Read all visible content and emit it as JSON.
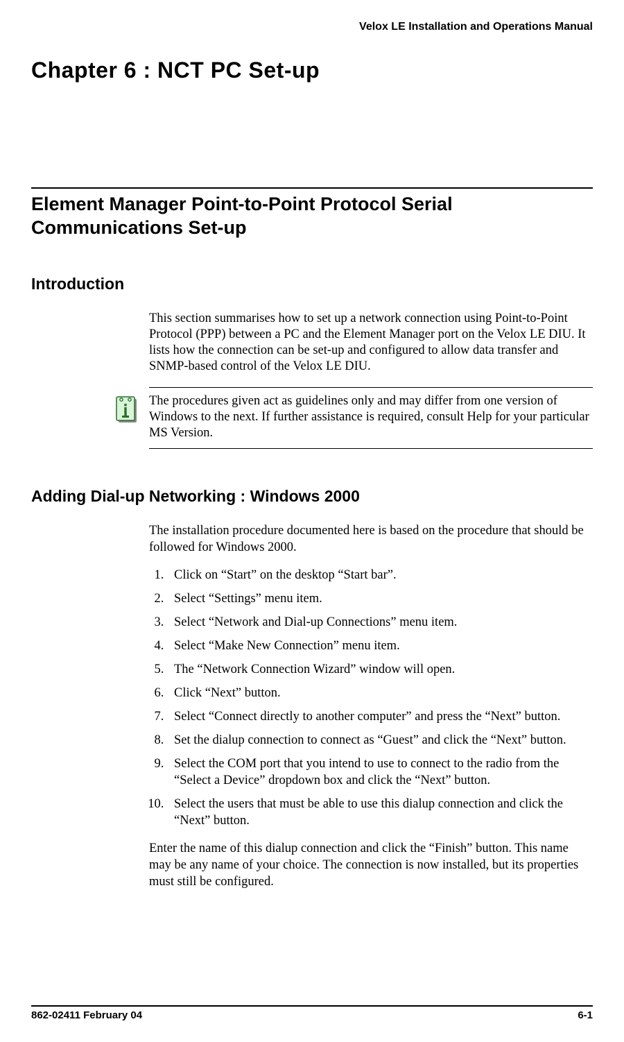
{
  "header": {
    "manual_title": "Velox LE Installation and Operations Manual"
  },
  "chapter": {
    "title": "Chapter 6 : NCT PC Set-up"
  },
  "section": {
    "title": "Element Manager Point-to-Point Protocol Serial Communications Set-up"
  },
  "introduction": {
    "heading": "Introduction",
    "paragraph": "This section summarises how to set up a network connection using Point-to-Point Protocol (PPP) between a PC and the Element Manager port on the Velox LE DIU.  It lists how the connection can be set-up and configured to allow data transfer and SNMP-based control of the Velox LE DIU.",
    "note": "The procedures given act as guidelines only and may differ from one version of Windows to the next.  If further assistance is required, consult Help for your particular MS Version."
  },
  "dialup": {
    "heading": "Adding Dial-up Networking : Windows 2000",
    "intro": "The installation procedure documented here is based on the procedure that should be followed for Windows 2000.",
    "steps": [
      "Click on “Start” on the desktop “Start bar”.",
      "Select “Settings” menu item.",
      "Select “Network and Dial-up Connections” menu item.",
      "Select “Make New Connection” menu item.",
      "The “Network Connection Wizard” window will open.",
      "Click “Next” button.",
      "Select “Connect directly to another computer” and press the “Next” button.",
      "Set the dialup connection to connect as “Guest” and click the “Next” button.",
      "Select the COM port that you intend to use to connect to the radio from the “Select a Device” dropdown box and click the “Next” button.",
      "Select the users that must be able to use this dialup connection and click the “Next” button."
    ],
    "closing": "Enter the name of this dialup connection and click the “Finish” button.  This name may be any name of your choice.  The connection is now installed, but its properties must still be configured."
  },
  "footer": {
    "doc_number": "862-02411 February 04",
    "page_number": "6-1"
  }
}
